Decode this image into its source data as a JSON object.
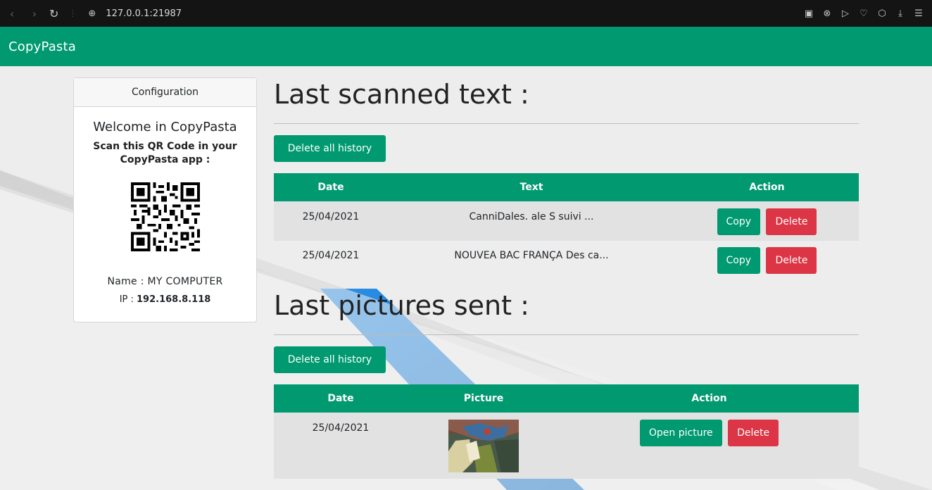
{
  "browser": {
    "url": "127.0.0.1:21987"
  },
  "navbar": {
    "brand": "CopyPasta"
  },
  "config_card": {
    "header": "Configuration",
    "welcome": "Welcome in CopyPasta",
    "scan_text": "Scan this QR Code in your CopyPasta app :",
    "name_label": "Name :",
    "name_value": "MY COMPUTER",
    "ip_label": "IP :",
    "ip_value": "192.168.8.118"
  },
  "text_section": {
    "title": "Last scanned text :",
    "delete_all_label": "Delete all history",
    "columns": [
      "Date",
      "Text",
      "Action"
    ],
    "rows": [
      {
        "date": "25/04/2021",
        "text": "CanniDales. ale S suivi ...",
        "copy_label": "Copy",
        "delete_label": "Delete"
      },
      {
        "date": "25/04/2021",
        "text": "NOUVEA BAC FRANÇA Des ca...",
        "copy_label": "Copy",
        "delete_label": "Delete"
      }
    ]
  },
  "picture_section": {
    "title": "Last pictures sent :",
    "delete_all_label": "Delete all history",
    "columns": [
      "Date",
      "Picture",
      "Action"
    ],
    "rows": [
      {
        "date": "25/04/2021",
        "open_label": "Open picture",
        "delete_label": "Delete"
      }
    ]
  },
  "colors": {
    "primary": "#009970",
    "danger": "#dc3545",
    "accent_blue": "#1a7fd6"
  }
}
